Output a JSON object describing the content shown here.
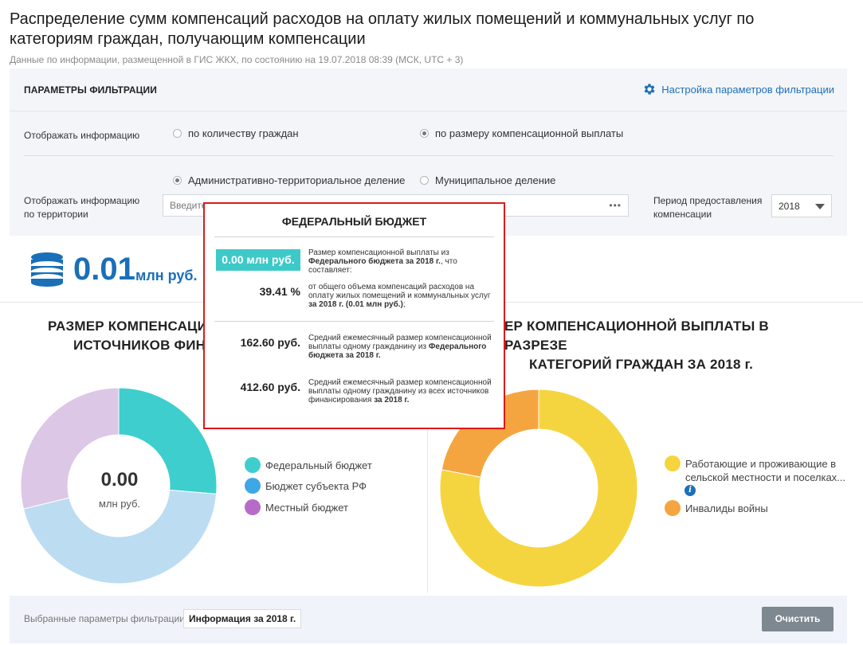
{
  "header": {
    "title": "Распределение сумм компенсаций расходов на оплату жилых помещений и коммунальных услуг по категориям граждан, получающим компенсации",
    "subtitle": "Данные по информации, размещенной в ГИС ЖКХ, по состоянию на 19.07.2018 08:39 (МСК, UTC + 3)"
  },
  "filters": {
    "title": "ПАРАМЕТРЫ ФИЛЬТРАЦИИ",
    "settings_label": "Настройка параметров фильтрации",
    "display_label": "Отображать информацию",
    "display_options": [
      {
        "label": "по количеству граждан",
        "selected": false
      },
      {
        "label": "по размеру компенсационной выплаты",
        "selected": true
      }
    ],
    "division_options": [
      {
        "label": "Административно-территориальное деление",
        "selected": true
      },
      {
        "label": "Муниципальное деление",
        "selected": false
      }
    ],
    "territory_label_1": "Отображать информацию",
    "territory_label_2": "по территории",
    "territory_placeholder": "Введите",
    "territory_dots": "•••",
    "period_label_1": "Период предоставления",
    "period_label_2": "компенсации",
    "period_value": "2018"
  },
  "summary": {
    "value": "0.01",
    "unit": "млн руб."
  },
  "left_section": {
    "title_line_1": "РАЗМЕР КОМПЕНСАЦИО",
    "title_line_2": "ИСТОЧНИКОВ ФИНА",
    "center_value": "0.00",
    "center_unit": "млн руб.",
    "legend": [
      {
        "label": "Федеральный бюджет",
        "color": "#3ecece"
      },
      {
        "label": "Бюджет субъекта РФ",
        "color": "#3ea7e6"
      },
      {
        "label": "Местный бюджет",
        "color": "#b76bc9"
      }
    ],
    "segments": [
      {
        "name": "Федеральный бюджет",
        "share": 0.2635,
        "color": "#3ecece"
      },
      {
        "name": "Бюджет субъекта РФ",
        "share": 0.4485,
        "color": "#bcdcf2"
      },
      {
        "name": "Местный бюджет",
        "share": 0.288,
        "color": "#dcc7e6"
      }
    ]
  },
  "right_section": {
    "title_line_1": "ЕР КОМПЕНСАЦИОННОЙ ВЫПЛАТЫ В РАЗРЕЗЕ",
    "title_line_2": "КАТЕГОРИЙ ГРАЖДАН ЗА 2018 г.",
    "legend": [
      {
        "label_1": "Работающие и проживающие в",
        "label_2": "сельской местности и поселках...",
        "color": "#f5d53f"
      },
      {
        "label_1": "Инвалиды войны",
        "label_2": "",
        "color": "#f5a53f"
      }
    ],
    "info_glyph": "i",
    "segments": [
      {
        "name": "Работающие и проживающие в сельской местности и поселках...",
        "share": 0.78,
        "color": "#f5d53f"
      },
      {
        "name": "Инвалиды войны",
        "share": 0.22,
        "color": "#f5a53f"
      }
    ]
  },
  "footer": {
    "label": "Выбранные параметры фильтрации:",
    "chip": "Информация за 2018 г.",
    "clear_label": "Очистить"
  },
  "tooltip": {
    "title": "ФЕДЕРАЛЬНЫЙ БЮДЖЕТ",
    "badge": "0.00 млн руб.",
    "badge_text_1": "Размер компенсационной выплаты из",
    "badge_text_2": "Федерального бюджета за 2018 г.",
    "badge_text_3": ", что",
    "badge_text_4": "составляет:",
    "percent": "39.41 %",
    "percent_text_1": "от общего объема компенсаций расходов на оплату жилых помещений и коммунальных услуг",
    "percent_text_2": "за 2018 г. (0.01 млн руб.)",
    "percent_text_3": ";",
    "avg_federal": "162.60 руб.",
    "avg_federal_text_1": "Средний ежемесячный размер компенсационной выплаты одному гражданину из",
    "avg_federal_text_2": "Федерального бюджета за 2018 г.",
    "avg_all": "412.60 руб.",
    "avg_all_text_1": "Средний ежемесячный размер компенсационной выплаты одному гражданину из всех источников финансирования",
    "avg_all_text_2": "за 2018 г."
  }
}
